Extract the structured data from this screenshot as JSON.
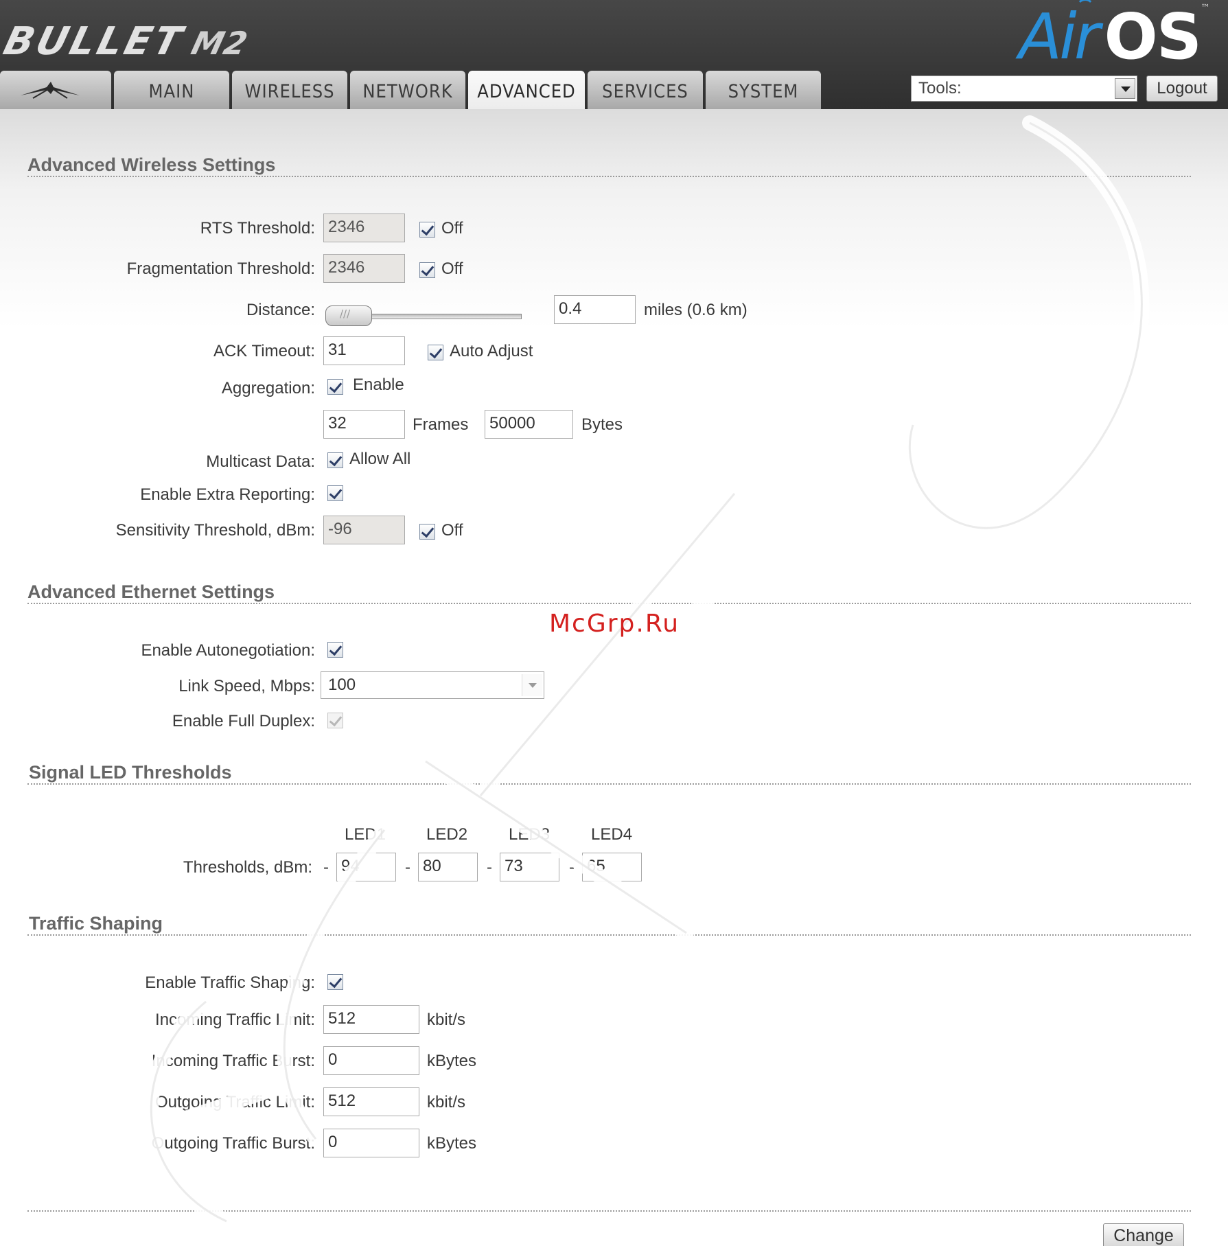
{
  "header": {
    "product_name": "BULLET",
    "product_model": "M2",
    "brand_air": "Air",
    "brand_os": "OS",
    "brand_tm": "™",
    "tabs": [
      {
        "label": ""
      },
      {
        "label": "MAIN"
      },
      {
        "label": "WIRELESS"
      },
      {
        "label": "NETWORK"
      },
      {
        "label": "ADVANCED"
      },
      {
        "label": "SERVICES"
      },
      {
        "label": "SYSTEM"
      }
    ],
    "active_tab": "ADVANCED",
    "tools_label": "Tools:",
    "logout_label": "Logout"
  },
  "wireless": {
    "title": "Advanced Wireless Settings",
    "rts_label": "RTS Threshold:",
    "rts_value": "2346",
    "rts_off_label": "Off",
    "frag_label": "Fragmentation Threshold:",
    "frag_value": "2346",
    "frag_off_label": "Off",
    "distance_label": "Distance:",
    "distance_value": "0.4",
    "distance_unit": "miles (0.6 km)",
    "ack_label": "ACK Timeout:",
    "ack_value": "31",
    "ack_auto_label": "Auto Adjust",
    "aggregation_label": "Aggregation:",
    "aggregation_enable_label": "Enable",
    "frames_value": "32",
    "frames_label": "Frames",
    "bytes_value": "50000",
    "bytes_label": "Bytes",
    "multicast_label": "Multicast Data:",
    "multicast_allow_label": "Allow All",
    "extra_reporting_label": "Enable Extra Reporting:",
    "sensitivity_label": "Sensitivity Threshold, dBm:",
    "sensitivity_value": "-96",
    "sensitivity_off_label": "Off"
  },
  "ethernet": {
    "title": "Advanced Ethernet Settings",
    "autoneg_label": "Enable Autonegotiation:",
    "link_speed_label": "Link Speed, Mbps:",
    "link_speed_value": "100",
    "full_duplex_label": "Enable Full Duplex:"
  },
  "led": {
    "title": "Signal LED Thresholds",
    "headers": [
      "LED1",
      "LED2",
      "LED3",
      "LED4"
    ],
    "thresholds_label": "Thresholds, dBm:",
    "dash": "-",
    "values": [
      "94",
      "80",
      "73",
      "65"
    ]
  },
  "traffic": {
    "title": "Traffic Shaping",
    "enable_label": "Enable Traffic Shaping:",
    "in_limit_label": "Incoming Traffic Limit:",
    "in_limit_value": "512",
    "in_limit_unit": "kbit/s",
    "in_burst_label": "Incoming Traffic Burst:",
    "in_burst_value": "0",
    "in_burst_unit": "kBytes",
    "out_limit_label": "Outgoing Traffic Limit:",
    "out_limit_value": "512",
    "out_limit_unit": "kbit/s",
    "out_burst_label": "Outgoing Traffic Burst:",
    "out_burst_value": "0",
    "out_burst_unit": "kBytes"
  },
  "footer": {
    "change_label": "Change"
  },
  "watermark": {
    "site": "McGrp.Ru"
  }
}
